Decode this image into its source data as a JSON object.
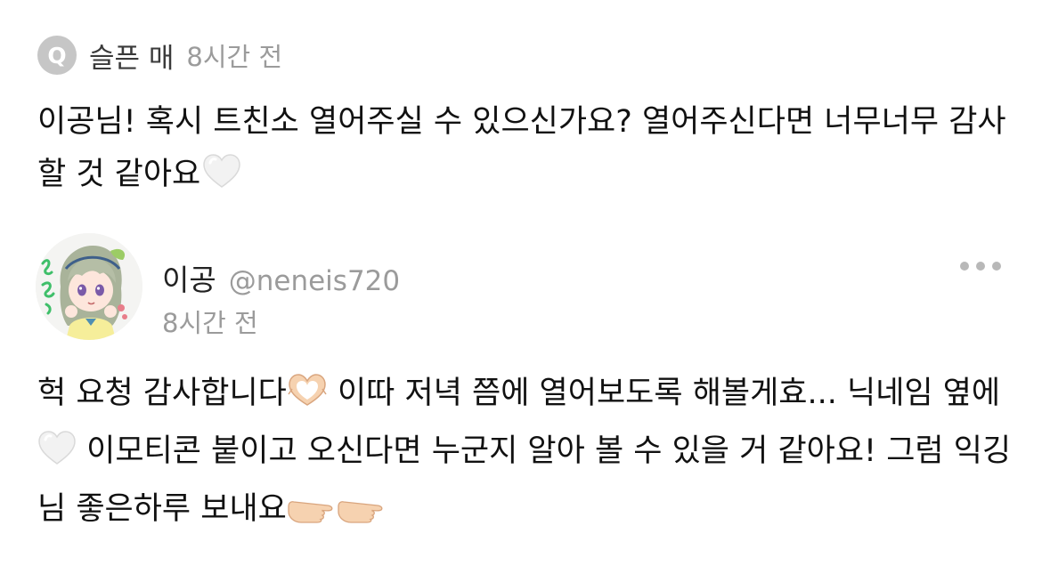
{
  "question": {
    "badge": "Q",
    "author": "슬픈 매",
    "time": "8시간 전",
    "text": "이공님! 혹시 트친소 열어주실 수 있으신가요? 열어주신다면 너무너무 감사할 것 같아요",
    "trailing_icon": "white-heart-icon"
  },
  "answer": {
    "avatar_icon": "anime-girl-avatar",
    "name": "이공",
    "handle": "@neneis720",
    "time": "8시간 전",
    "more_icon": "more-dots-icon",
    "segments": [
      "헉 요청 감사합니다",
      " 이따 저녁 쯤에 열어보도록 해볼게효... 닉네임 옆에 ",
      " 이모티콘 붙이고 오신다면 누군지 알아 볼 수 있을 거 같아요! 그럼 익깅님 좋은하루 보내요"
    ],
    "icons": [
      "heart-hands-icon",
      "white-heart-icon",
      "pointing-hand-icon",
      "pointing-hand-icon"
    ]
  },
  "colors": {
    "badge_bg": "#c6c6c6",
    "muted_text": "#9b9b9b",
    "main_text": "#111111"
  }
}
